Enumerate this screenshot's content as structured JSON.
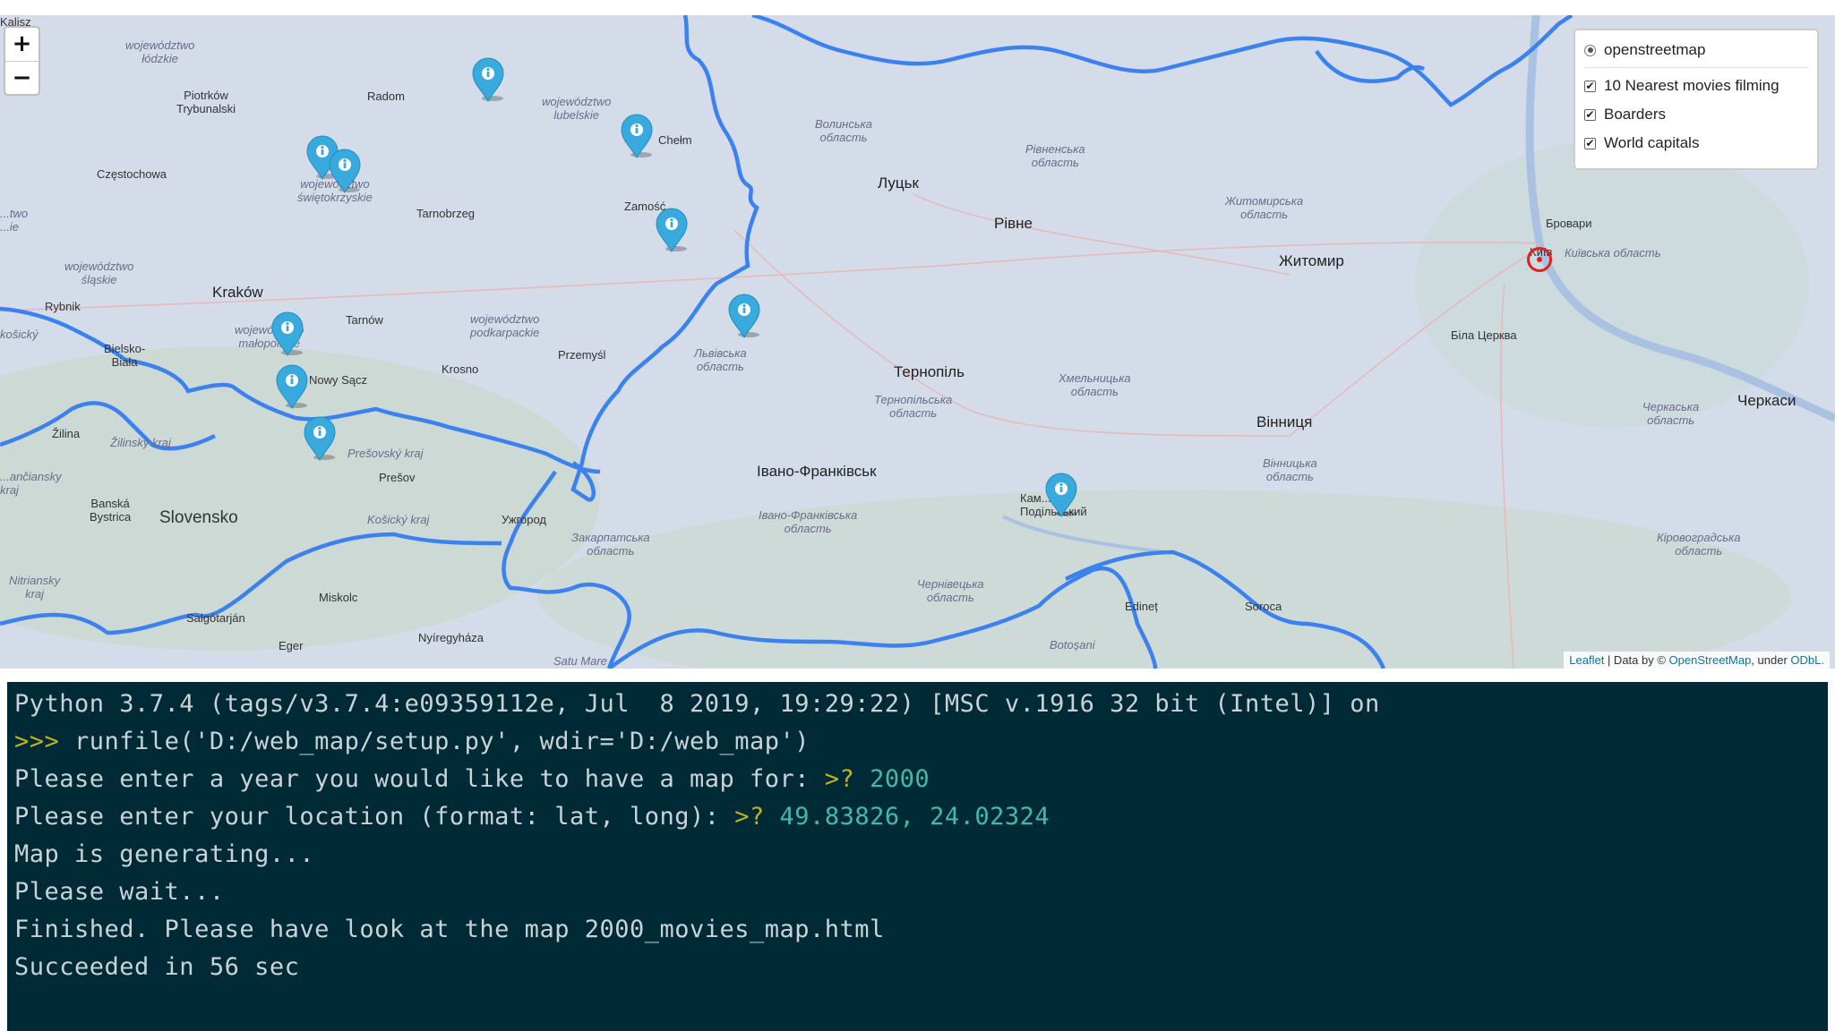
{
  "map": {
    "zoom_in": "+",
    "zoom_out": "−",
    "layers": [
      {
        "type": "radio",
        "label": "openstreetmap",
        "checked": true
      },
      {
        "type": "checkbox",
        "label": "10 Nearest movies filming",
        "checked": true
      },
      {
        "type": "checkbox",
        "label": "Boarders",
        "checked": true
      },
      {
        "type": "checkbox",
        "label": "World capitals",
        "checked": true
      }
    ],
    "attribution": {
      "leaflet": "Leaflet",
      "data_by": " | Data by © ",
      "osm": "OpenStreetMap",
      "under": ", under ",
      "odbl": "ODbL."
    },
    "places": {
      "kalisz": "Kalisz",
      "lodzkie": "województwo\nłódzkie",
      "piotrkow": "Piotrków\nTrybunalski",
      "radom": "Radom",
      "lubelskie": "województwo\nlubelskie",
      "chelm": "Chełm",
      "volynska": "Волинська\nобласть",
      "rivnenska": "Рівненська\nобласть",
      "czestochowa": "Częstochowa",
      "swietokrzyskie": "województwo\nświętokrzyskie",
      "tarnobrzeg": "Tarnobrzeg",
      "zamosc": "Zamość",
      "lutsk": "Луцьк",
      "rivne": "Рівне",
      "zhytomyrska": "Житомирська\nобласть",
      "zhytomyr": "Житомир",
      "brovary": "Бровари",
      "kyiv": "Київ",
      "kyivska": "Київська область",
      "slaskie": "województwo\nśląskie",
      "krakow": "Kraków",
      "tarnow": "Tarnów",
      "podkarpackie": "województwo\npodkarpackie",
      "rybnik": "Rybnik",
      "kosicsky_left": "košický",
      "malopolskie": "województwo\nmałopolskie",
      "bielsko": "Bielsko-\nBiała",
      "przemysl": "Przemyśl",
      "lvivska": "Львівська\nобласть",
      "krosno": "Krosno",
      "nowy_sacz": "Nowy Sącz",
      "bila_tserkva": "Біла Церква",
      "ternopil": "Тернопіль",
      "ternopilska": "Тернопільська\nобласть",
      "khmelnytska": "Хмельницька\nобласть",
      "cherkaska": "Черкаська\nобласть",
      "cherkasy": "Черкаси",
      "zilina": "Žilina",
      "zilinsky": "Žilinský kraj",
      "presovsky": "Prešovský kraj",
      "vinnytsia": "Вінниця",
      "presov": "Prešov",
      "ivano": "Івано-Франківськ",
      "vinnytska": "Вінницька\nобласть",
      "banskobystricky": "...ančiansky\nkraj",
      "banska": "Banská\nBystrica",
      "slovensko": "Slovensko",
      "kosicky": "Košický kraj",
      "uzhhorod": "Ужгород",
      "ivanoska": "Івано-Франківська\nобласть",
      "kamianets": "Кам...ць-\nПодільський",
      "zakarpatska": "Закарпатська\nобласть",
      "kirovohradska": "Кіровоградська\nобласть",
      "nitriansky": "Nitriansky\nkraj",
      "miskolc": "Miskolc",
      "chernivetska": "Чернівецька\nобласть",
      "salgotarjan": "Salgótarján",
      "edinet": "Edineț",
      "soroca": "Soroca",
      "nyiregyhaza": "Nyíregyháza",
      "eger": "Eger",
      "botosani": "Botoșani",
      "satu_mare": "Satu Mare",
      "left_edge": "...two\n...ie"
    }
  },
  "console": {
    "lines": [
      {
        "text": "Python 3.7.4 (tags/v3.7.4:e09359112e, Jul  8 2019, 19:29:22) [MSC v.1916 32 bit (Intel)] on"
      },
      {
        "prompt": ">>> ",
        "text": "runfile('D:/web_map/setup.py', wdir='D:/web_map')"
      },
      {
        "text": "Please enter a year you would like to have a map for: ",
        "prompt": ">? ",
        "input": "2000"
      },
      {
        "text": "Please enter your location (format: lat, long): ",
        "prompt": ">? ",
        "input": "49.83826, 24.02324"
      },
      {
        "text": "Map is generating..."
      },
      {
        "text": "Please wait..."
      },
      {
        "text": "Finished. Please have look at the map 2000_movies_map.html"
      },
      {
        "text": "Succeeded in 56 sec"
      }
    ]
  },
  "colors": {
    "border": "#3b82f0",
    "pin": "#38aadd",
    "capital_marker": "#e02020",
    "console_bg": "#002a36",
    "console_prompt": "#c3b021",
    "console_input": "#43b8b0"
  }
}
